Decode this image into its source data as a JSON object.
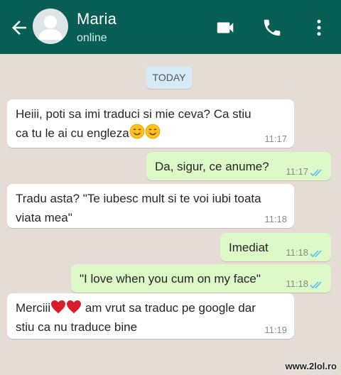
{
  "header": {
    "contact_name": "Maria",
    "status": "online",
    "icons": [
      "back-arrow-icon",
      "avatar-icon",
      "video-call-icon",
      "phone-icon",
      "more-vertical-icon"
    ],
    "background_color": "#075e54"
  },
  "chat": {
    "date_label": "TODAY",
    "messages": [
      {
        "direction": "incoming",
        "line1": "Heiii, poti sa imi traduci si mie ceva? Ca stiu",
        "line2": "ca tu le ai cu engleza",
        "time": "11:17"
      },
      {
        "direction": "outgoing",
        "text": "Da, sigur, ce anume?",
        "time": "11:17",
        "read": true
      },
      {
        "direction": "incoming",
        "line1": "Tradu asta? \"Te iubesc mult si te voi iubi toata",
        "line2": "viata mea\"",
        "time": "11:18"
      },
      {
        "direction": "outgoing",
        "text": "Imediat",
        "time": "11:18",
        "read": true
      },
      {
        "direction": "outgoing",
        "text": "\"I love when you cum on my face\"",
        "time": "11:18",
        "read": true
      },
      {
        "direction": "incoming",
        "line1_a": "Merciii",
        "line1_b": "am vrut sa traduc pe google dar",
        "line2": "stiu ca nu traduce bine",
        "time": "11:19"
      }
    ],
    "colors": {
      "incoming": "#ffffff",
      "outgoing": "#dcf8c6",
      "read_ticks": "#4fc3f7",
      "wallpaper": "#e5ddd5"
    }
  },
  "watermark": "www.2lol.ro"
}
